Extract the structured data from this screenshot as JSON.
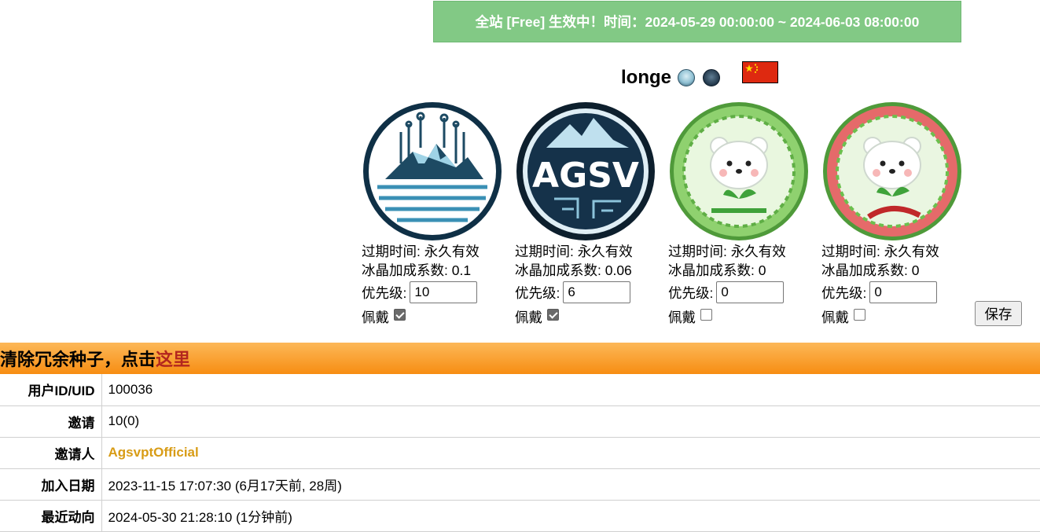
{
  "banner": {
    "text": "全站 [Free] 生效中！时间：2024-05-29 00:00:00 ~ 2024-06-03 08:00:00"
  },
  "user": {
    "name": "longe",
    "flag": "china-flag"
  },
  "medals": [
    {
      "icon": "ice-mountain-medal-icon",
      "expire": "过期时间: 永久有效",
      "bonus": "冰晶加成系数: 0.1",
      "priority_label": "优先级:",
      "priority": "10",
      "wear_label": "佩戴",
      "worn": true
    },
    {
      "icon": "agsv-medal-icon",
      "expire": "过期时间: 永久有效",
      "bonus": "冰晶加成系数: 0.06",
      "priority_label": "优先级:",
      "priority": "6",
      "wear_label": "佩戴",
      "worn": true
    },
    {
      "icon": "bear-sprout-medal-icon",
      "expire": "过期时间: 永久有效",
      "bonus": "冰晶加成系数: 0",
      "priority_label": "优先级:",
      "priority": "0",
      "wear_label": "佩戴",
      "worn": false
    },
    {
      "icon": "bear-new-year-medal-icon",
      "expire": "过期时间: 永久有效",
      "bonus": "冰晶加成系数: 0",
      "priority_label": "优先级:",
      "priority": "0",
      "wear_label": "佩戴",
      "worn": false
    }
  ],
  "save_label": "保存",
  "cleanup": {
    "text": "清除冗余种子，点击",
    "link": "这里"
  },
  "info_rows": [
    {
      "label": "用户ID/UID",
      "value": "100036"
    },
    {
      "label": "邀请",
      "value": "10(0)"
    },
    {
      "label": "邀请人",
      "value": "AgsvptOfficial"
    },
    {
      "label": "加入日期",
      "value": "2023-11-15 17:07:30 (6月17天前, 28周)"
    },
    {
      "label": "最近动向",
      "value": "2024-05-30 21:28:10 (1分钟前)"
    }
  ],
  "colors": {
    "banner_bg": "#82c985",
    "bar_orange": "#f78d12",
    "link_red": "#b3261e",
    "inviter_gold": "#d89c16"
  }
}
